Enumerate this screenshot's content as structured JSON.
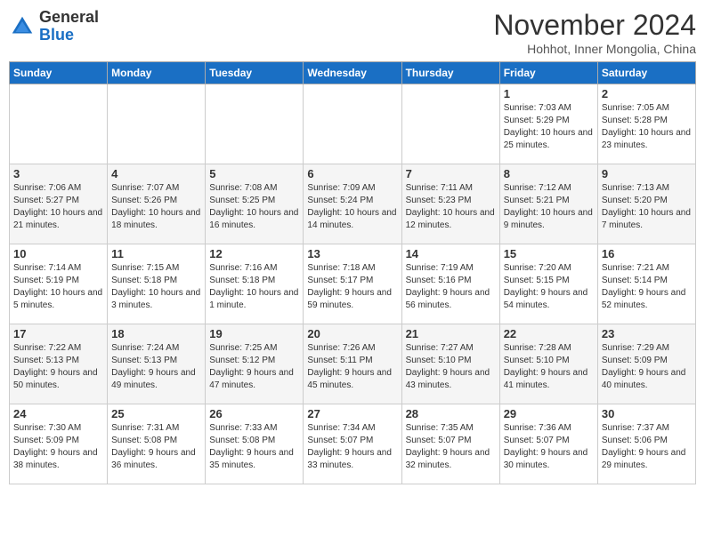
{
  "logo": {
    "general": "General",
    "blue": "Blue"
  },
  "title": "November 2024",
  "subtitle": "Hohhot, Inner Mongolia, China",
  "headers": [
    "Sunday",
    "Monday",
    "Tuesday",
    "Wednesday",
    "Thursday",
    "Friday",
    "Saturday"
  ],
  "weeks": [
    [
      {
        "day": "",
        "info": ""
      },
      {
        "day": "",
        "info": ""
      },
      {
        "day": "",
        "info": ""
      },
      {
        "day": "",
        "info": ""
      },
      {
        "day": "",
        "info": ""
      },
      {
        "day": "1",
        "info": "Sunrise: 7:03 AM\nSunset: 5:29 PM\nDaylight: 10 hours and 25 minutes."
      },
      {
        "day": "2",
        "info": "Sunrise: 7:05 AM\nSunset: 5:28 PM\nDaylight: 10 hours and 23 minutes."
      }
    ],
    [
      {
        "day": "3",
        "info": "Sunrise: 7:06 AM\nSunset: 5:27 PM\nDaylight: 10 hours and 21 minutes."
      },
      {
        "day": "4",
        "info": "Sunrise: 7:07 AM\nSunset: 5:26 PM\nDaylight: 10 hours and 18 minutes."
      },
      {
        "day": "5",
        "info": "Sunrise: 7:08 AM\nSunset: 5:25 PM\nDaylight: 10 hours and 16 minutes."
      },
      {
        "day": "6",
        "info": "Sunrise: 7:09 AM\nSunset: 5:24 PM\nDaylight: 10 hours and 14 minutes."
      },
      {
        "day": "7",
        "info": "Sunrise: 7:11 AM\nSunset: 5:23 PM\nDaylight: 10 hours and 12 minutes."
      },
      {
        "day": "8",
        "info": "Sunrise: 7:12 AM\nSunset: 5:21 PM\nDaylight: 10 hours and 9 minutes."
      },
      {
        "day": "9",
        "info": "Sunrise: 7:13 AM\nSunset: 5:20 PM\nDaylight: 10 hours and 7 minutes."
      }
    ],
    [
      {
        "day": "10",
        "info": "Sunrise: 7:14 AM\nSunset: 5:19 PM\nDaylight: 10 hours and 5 minutes."
      },
      {
        "day": "11",
        "info": "Sunrise: 7:15 AM\nSunset: 5:18 PM\nDaylight: 10 hours and 3 minutes."
      },
      {
        "day": "12",
        "info": "Sunrise: 7:16 AM\nSunset: 5:18 PM\nDaylight: 10 hours and 1 minute."
      },
      {
        "day": "13",
        "info": "Sunrise: 7:18 AM\nSunset: 5:17 PM\nDaylight: 9 hours and 59 minutes."
      },
      {
        "day": "14",
        "info": "Sunrise: 7:19 AM\nSunset: 5:16 PM\nDaylight: 9 hours and 56 minutes."
      },
      {
        "day": "15",
        "info": "Sunrise: 7:20 AM\nSunset: 5:15 PM\nDaylight: 9 hours and 54 minutes."
      },
      {
        "day": "16",
        "info": "Sunrise: 7:21 AM\nSunset: 5:14 PM\nDaylight: 9 hours and 52 minutes."
      }
    ],
    [
      {
        "day": "17",
        "info": "Sunrise: 7:22 AM\nSunset: 5:13 PM\nDaylight: 9 hours and 50 minutes."
      },
      {
        "day": "18",
        "info": "Sunrise: 7:24 AM\nSunset: 5:13 PM\nDaylight: 9 hours and 49 minutes."
      },
      {
        "day": "19",
        "info": "Sunrise: 7:25 AM\nSunset: 5:12 PM\nDaylight: 9 hours and 47 minutes."
      },
      {
        "day": "20",
        "info": "Sunrise: 7:26 AM\nSunset: 5:11 PM\nDaylight: 9 hours and 45 minutes."
      },
      {
        "day": "21",
        "info": "Sunrise: 7:27 AM\nSunset: 5:10 PM\nDaylight: 9 hours and 43 minutes."
      },
      {
        "day": "22",
        "info": "Sunrise: 7:28 AM\nSunset: 5:10 PM\nDaylight: 9 hours and 41 minutes."
      },
      {
        "day": "23",
        "info": "Sunrise: 7:29 AM\nSunset: 5:09 PM\nDaylight: 9 hours and 40 minutes."
      }
    ],
    [
      {
        "day": "24",
        "info": "Sunrise: 7:30 AM\nSunset: 5:09 PM\nDaylight: 9 hours and 38 minutes."
      },
      {
        "day": "25",
        "info": "Sunrise: 7:31 AM\nSunset: 5:08 PM\nDaylight: 9 hours and 36 minutes."
      },
      {
        "day": "26",
        "info": "Sunrise: 7:33 AM\nSunset: 5:08 PM\nDaylight: 9 hours and 35 minutes."
      },
      {
        "day": "27",
        "info": "Sunrise: 7:34 AM\nSunset: 5:07 PM\nDaylight: 9 hours and 33 minutes."
      },
      {
        "day": "28",
        "info": "Sunrise: 7:35 AM\nSunset: 5:07 PM\nDaylight: 9 hours and 32 minutes."
      },
      {
        "day": "29",
        "info": "Sunrise: 7:36 AM\nSunset: 5:07 PM\nDaylight: 9 hours and 30 minutes."
      },
      {
        "day": "30",
        "info": "Sunrise: 7:37 AM\nSunset: 5:06 PM\nDaylight: 9 hours and 29 minutes."
      }
    ]
  ]
}
